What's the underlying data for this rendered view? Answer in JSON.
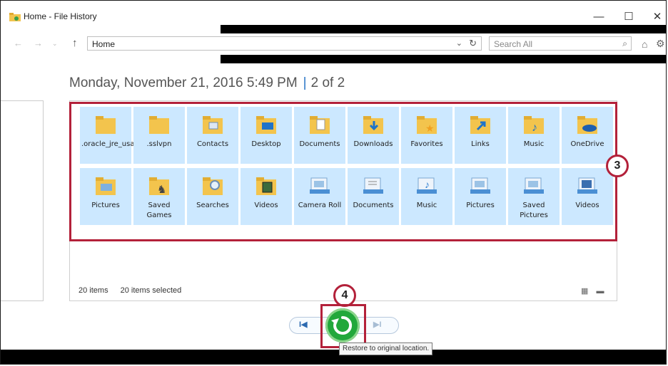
{
  "window": {
    "title": "Home - File History",
    "minimize": "—",
    "maximize": "☐",
    "close": "✕"
  },
  "nav": {
    "back": "←",
    "forward": "→",
    "up": "↑",
    "address": "Home",
    "address_dropdown": "⌄",
    "refresh": "↻",
    "search_placeholder": "Search All",
    "search_icon": "⌕",
    "home_icon": "⌂",
    "settings_icon": "⚙"
  },
  "header": {
    "date": "Monday, November 21, 2016 5:49 PM",
    "separator": "|",
    "page": "2 of 2"
  },
  "items_row1": [
    {
      "label": ".oracle_jre_usage",
      "icon": "folder-icon"
    },
    {
      "label": ".sslvpn",
      "icon": "folder-icon"
    },
    {
      "label": "Contacts",
      "icon": "contacts-folder-icon"
    },
    {
      "label": "Desktop",
      "icon": "desktop-folder-icon"
    },
    {
      "label": "Documents",
      "icon": "documents-folder-icon"
    },
    {
      "label": "Downloads",
      "icon": "downloads-folder-icon"
    },
    {
      "label": "Favorites",
      "icon": "favorites-folder-icon"
    },
    {
      "label": "Links",
      "icon": "links-folder-icon"
    },
    {
      "label": "Music",
      "icon": "music-folder-icon"
    },
    {
      "label": "OneDrive",
      "icon": "onedrive-folder-icon"
    }
  ],
  "items_row2": [
    {
      "label": "Pictures",
      "icon": "pictures-folder-icon"
    },
    {
      "label": "Saved Games",
      "icon": "saved-games-folder-icon"
    },
    {
      "label": "Searches",
      "icon": "searches-folder-icon"
    },
    {
      "label": "Videos",
      "icon": "videos-folder-icon"
    },
    {
      "label": "Camera Roll",
      "icon": "library-camera-roll-icon"
    },
    {
      "label": "Documents",
      "icon": "library-documents-icon"
    },
    {
      "label": "Music",
      "icon": "library-music-icon"
    },
    {
      "label": "Pictures",
      "icon": "library-pictures-icon"
    },
    {
      "label": "Saved Pictures",
      "icon": "library-saved-pictures-icon"
    },
    {
      "label": "Videos",
      "icon": "library-videos-icon"
    }
  ],
  "status": {
    "count": "20 items",
    "selected": "20 items selected",
    "view_icons": "▦ ▬"
  },
  "callouts": {
    "items": "3",
    "restore": "4"
  },
  "playback": {
    "previous": "I◀",
    "next": "▶I",
    "tooltip": "Restore to original location."
  },
  "colors": {
    "accent_red": "#b3213a",
    "selection": "#cce8ff",
    "restore_green": "#22a83b",
    "folder_yellow": "#f3c44d"
  }
}
